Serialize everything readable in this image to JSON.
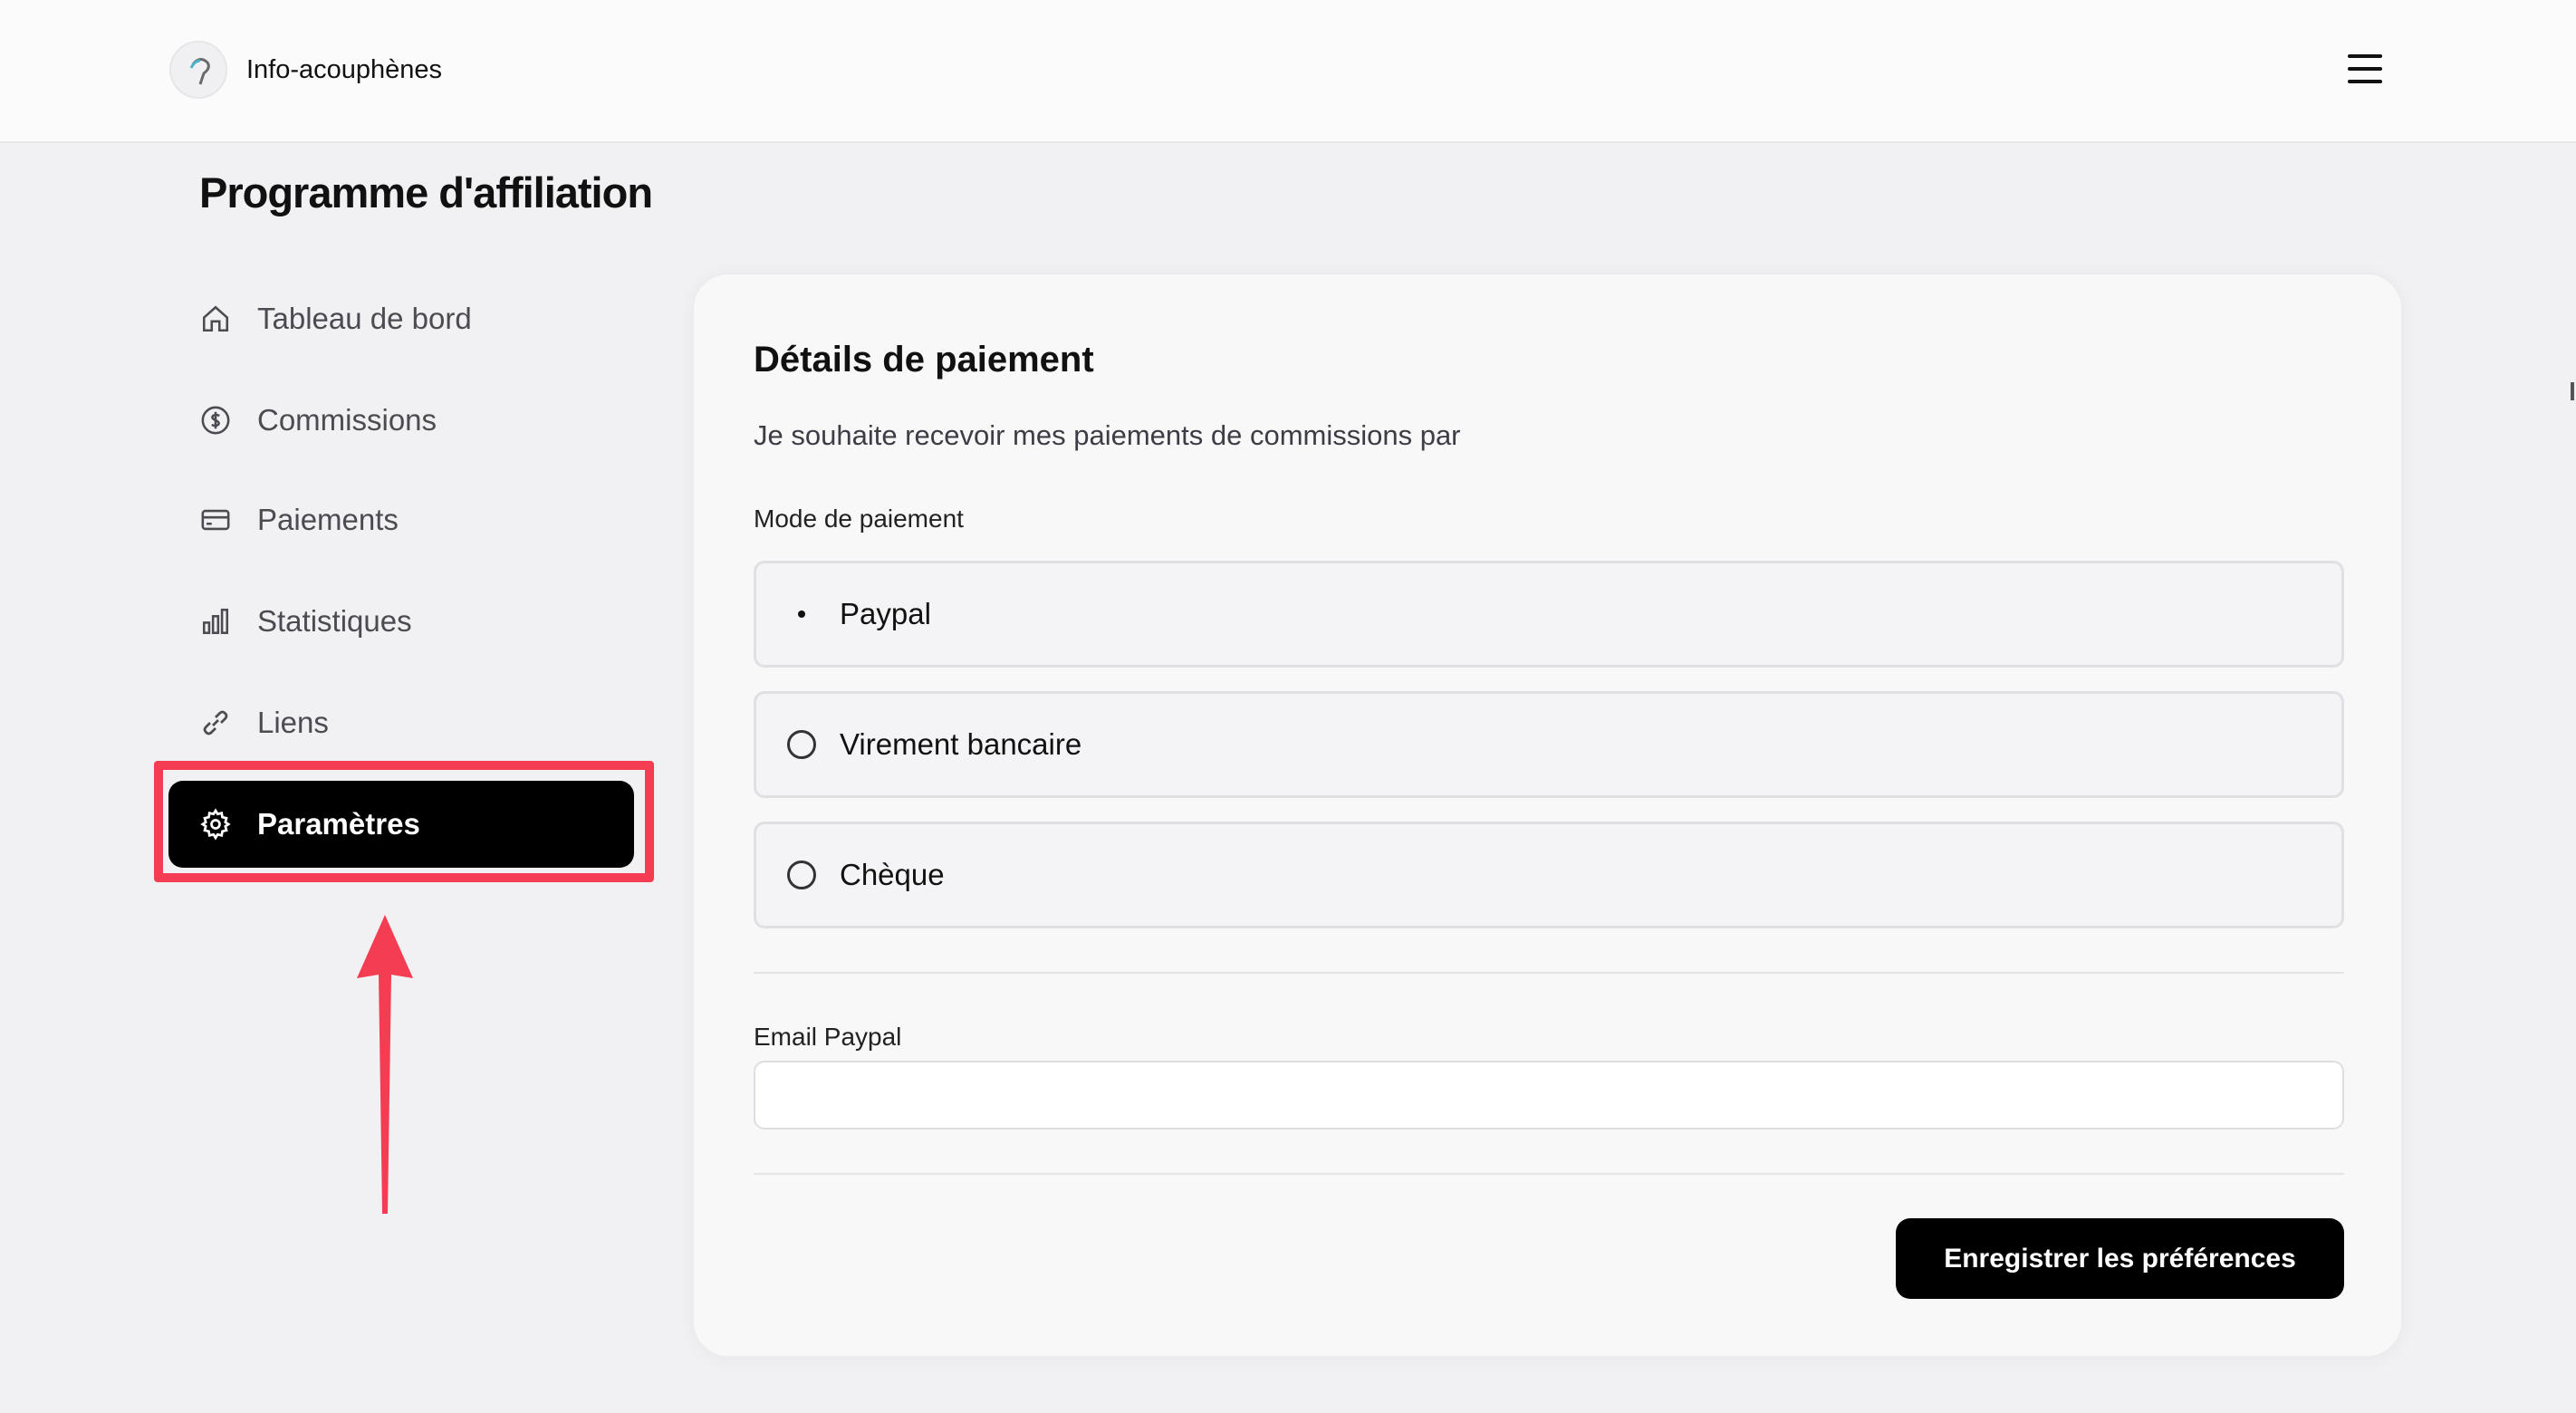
{
  "header": {
    "brand": "Info-acouphènes"
  },
  "page_title": "Programme d'affiliation",
  "sidebar": {
    "items": [
      {
        "label": "Tableau de bord",
        "icon": "home-icon"
      },
      {
        "label": "Commissions",
        "icon": "dollar-circle-icon"
      },
      {
        "label": "Paiements",
        "icon": "credit-card-icon"
      },
      {
        "label": "Statistiques",
        "icon": "bar-chart-icon"
      },
      {
        "label": "Liens",
        "icon": "link-icon"
      },
      {
        "label": "Paramètres",
        "icon": "gear-icon",
        "active": true
      }
    ]
  },
  "card": {
    "title": "Détails de paiement",
    "subtitle": "Je souhaite recevoir mes paiements de commissions par",
    "mode_label": "Mode de paiement",
    "options": [
      {
        "label": "Paypal",
        "selected": true
      },
      {
        "label": "Virement bancaire",
        "selected": false
      },
      {
        "label": "Chèque",
        "selected": false
      }
    ],
    "email_label": "Email Paypal",
    "email_value": "",
    "save_label": "Enregistrer les préférences"
  },
  "colors": {
    "accent": "#000000",
    "annotation": "#f43d52",
    "background": "#f1f1f3"
  }
}
